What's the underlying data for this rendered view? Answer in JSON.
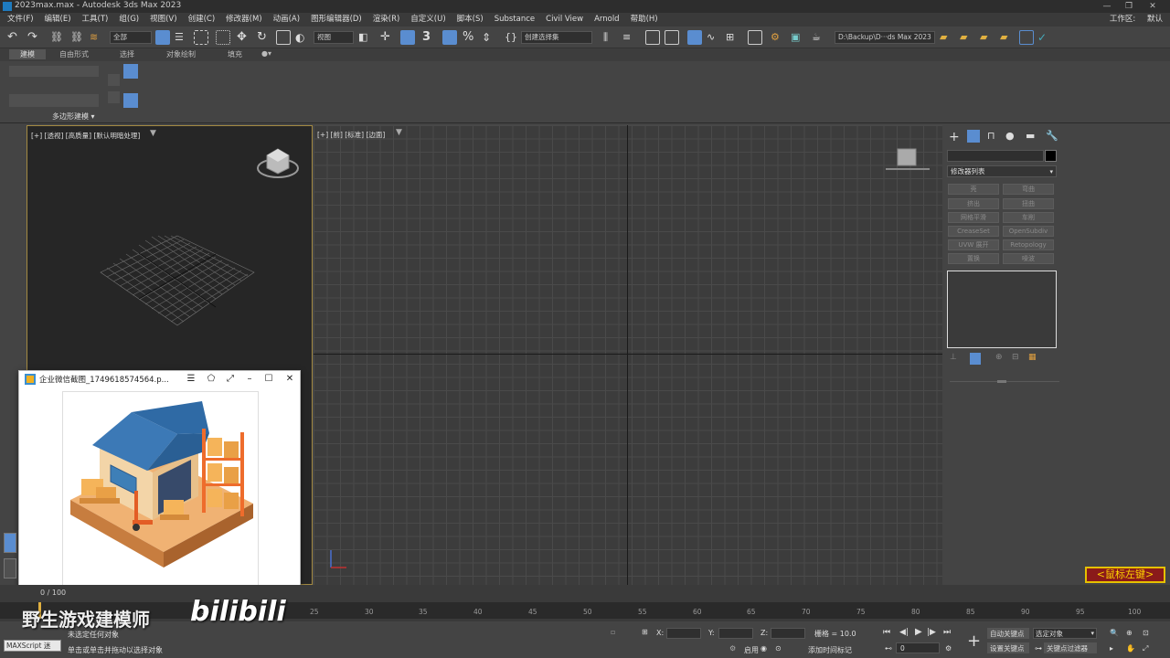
{
  "window": {
    "title": "2023max.max - Autodesk 3ds Max 2023"
  },
  "menubar": {
    "items": [
      "文件(F)",
      "编辑(E)",
      "工具(T)",
      "组(G)",
      "视图(V)",
      "创建(C)",
      "修改器(M)",
      "动画(A)",
      "图形编辑器(D)",
      "渲染(R)",
      "自定义(U)",
      "脚本(S)",
      "Substance",
      "Civil View",
      "Arnold",
      "帮助(H)"
    ],
    "workspace_label": "工作区:",
    "workspace_value": "默认"
  },
  "toolbar": {
    "selection_filter": "全部",
    "ref_coord": "视图",
    "named_selection": "创建选择集",
    "project_path": "D:\\Backup\\D···ds Max 2023"
  },
  "ribbon": {
    "tabs": [
      "建模",
      "自由形式",
      "选择",
      "对象绘制",
      "填充"
    ],
    "group_label": "多边形建模"
  },
  "viewports": {
    "left_label": "[+] [透视] [高质量] [默认明暗处理]",
    "main_label": "[+] [前] [标准] [边面]"
  },
  "command_panel": {
    "modifier_list": "修改器列表",
    "buttons": [
      [
        "壳",
        "弯曲"
      ],
      [
        "挤出",
        "扭曲"
      ],
      [
        "网格平滑",
        "车削"
      ],
      [
        "CreaseSet",
        "OpenSubdiv"
      ],
      [
        "UVW 展开",
        "Retopology"
      ],
      [
        "置换",
        "噪波"
      ]
    ]
  },
  "image_window": {
    "title": "企业微信截图_1749618574564.p..."
  },
  "timeline": {
    "frame_counter": "0 / 100",
    "ticks": [
      "15",
      "25",
      "30",
      "35",
      "40",
      "45",
      "50",
      "55",
      "60",
      "65",
      "70",
      "75",
      "80",
      "85",
      "90",
      "95",
      "100"
    ]
  },
  "status": {
    "maxscript": "MAXScript 迷",
    "line1": "未选定任何对象",
    "line2": "单击或单击并拖动以选择对象",
    "x_label": "X:",
    "y_label": "Y:",
    "z_label": "Z:",
    "grid_label": "栅格 = 10.0",
    "enable": "启用",
    "add_time_tag": "添加时间标记",
    "autokey": "自动关键点",
    "set_key": "设置关键点",
    "selected": "选定对象",
    "key_filters": "关键点过滤器",
    "frame_value": "0"
  },
  "overlay": {
    "watermark": "野生游戏建模师",
    "bilibili": "bilibili",
    "mouse_hint": "<鼠标左键>"
  }
}
